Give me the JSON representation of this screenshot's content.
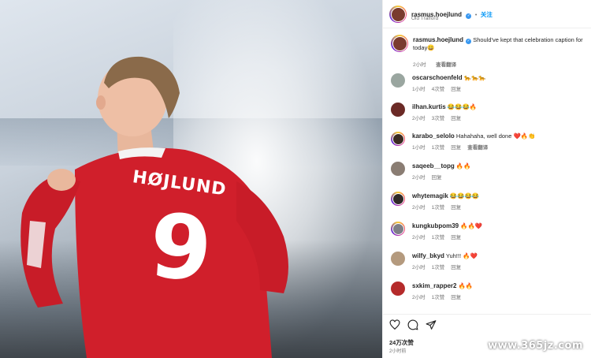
{
  "post": {
    "username": "rasmus.hoejlund",
    "location": "Old Trafford",
    "follow_label": "关注",
    "jersey_name": "HØJLUND",
    "jersey_number": "9",
    "caption": {
      "username": "rasmus.hoejlund",
      "text": "Should've kept that celebration caption for today😄",
      "time": "2小时",
      "translate": "查看翻译"
    },
    "likes": "24万次赞",
    "time_ago": "2小时前"
  },
  "comments": [
    {
      "username": "oscarschoenfeld",
      "text": "🐆🐆🐆",
      "time": "1小时",
      "likes": "4次赞",
      "reply": "回复"
    },
    {
      "username": "ilhan.kurtis",
      "text": "😂😂😂🔥",
      "time": "2小时",
      "likes": "3次赞",
      "reply": "回复"
    },
    {
      "username": "karabo_selolo",
      "text": "Hahahaha, well done ❤️🔥👏",
      "time": "1小时",
      "likes": "1次赞",
      "reply": "回复",
      "translate": "查看翻译"
    },
    {
      "username": "saqeeb__topg",
      "text": "🔥🔥",
      "time": "2小时",
      "reply": "回复"
    },
    {
      "username": "whytemagik",
      "text": "😂😂😂😂",
      "time": "2小时",
      "likes": "1次赞",
      "reply": "回复"
    },
    {
      "username": "kungkubpom39",
      "text": "🔥🔥❤️",
      "time": "2小时",
      "likes": "1次赞",
      "reply": "回复"
    },
    {
      "username": "wilfy_bkyd",
      "text": "Yuh!!! 🔥❤️",
      "time": "2小时",
      "likes": "1次赞",
      "reply": "回复"
    },
    {
      "username": "sxkim_rapper2",
      "text": "🔥🔥",
      "time": "2小时",
      "likes": "1次赞",
      "reply": "回复"
    }
  ],
  "icons": {
    "like": "heart-icon",
    "comment": "comment-icon",
    "share": "send-icon"
  },
  "watermark": "www.365jz.com",
  "colors": {
    "jersey_red": "#d01f2b",
    "follow_blue": "#0095f6",
    "verified_blue": "#3897f0"
  }
}
